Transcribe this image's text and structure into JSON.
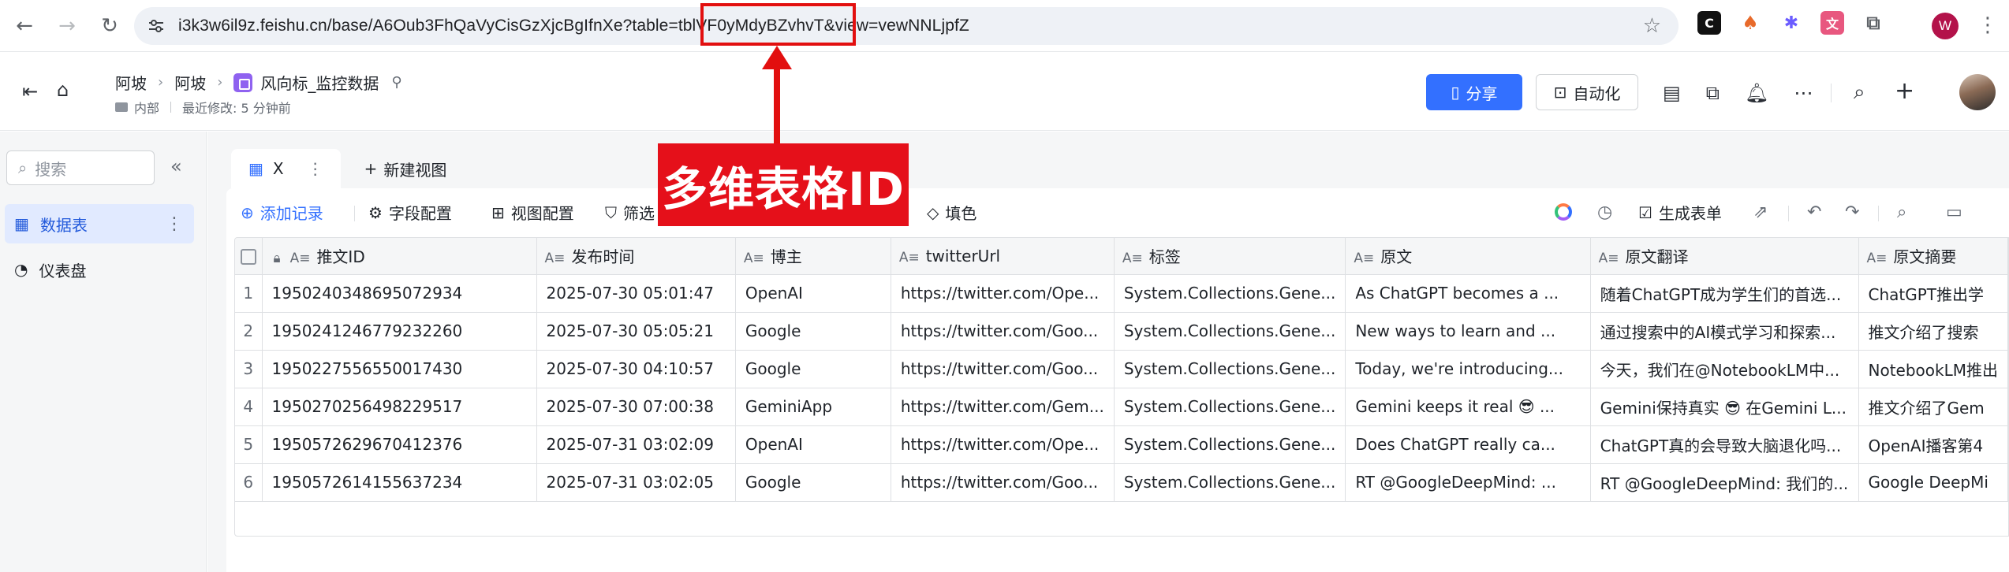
{
  "browser": {
    "url": "i3k3w6il9z.feishu.cn/base/A6Oub3FhQaVyCisGzXjcBgIfnXe?table=tblVF0yMdyBZvhvT&view=vewNNLjpfZ",
    "profile_initial": "W"
  },
  "header": {
    "breadcrumbs": [
      "阿坡",
      "阿坡"
    ],
    "doc_title": "风向标_监控数据",
    "visibility": "内部",
    "last_modified": "最近修改: 5 分钟前",
    "share_label": "分享",
    "automation_label": "自动化"
  },
  "sidebar": {
    "search_placeholder": "搜索",
    "items": [
      {
        "label": "数据表",
        "icon": "table-icon"
      },
      {
        "label": "仪表盘",
        "icon": "dashboard-icon"
      }
    ]
  },
  "views": {
    "active_tab": "X",
    "new_view_label": "新建视图"
  },
  "toolbar": {
    "add_record": "添加记录",
    "field_config": "字段配置",
    "view_config": "视图配置",
    "filter": "筛选",
    "fill_color": "填色",
    "generate_form": "生成表单"
  },
  "table": {
    "columns": [
      "推文ID",
      "发布时间",
      "博主",
      "twitterUrl",
      "标签",
      "原文",
      "原文翻译",
      "原文摘要"
    ],
    "rows": [
      {
        "n": "1",
        "cells": [
          "1950240348695072934",
          "2025-07-30 05:01:47",
          "OpenAI",
          "https://twitter.com/Ope...",
          "System.Collections.Gene...",
          "As ChatGPT becomes a ...",
          "随着ChatGPT成为学生们的首选...",
          "ChatGPT推出学"
        ]
      },
      {
        "n": "2",
        "cells": [
          "1950241246779232260",
          "2025-07-30 05:05:21",
          "Google",
          "https://twitter.com/Goo...",
          "System.Collections.Gene...",
          "New ways to learn and ...",
          "通过搜索中的AI模式学习和探索...",
          "推文介绍了搜索"
        ]
      },
      {
        "n": "3",
        "cells": [
          "1950227556550017430",
          "2025-07-30 04:10:57",
          "Google",
          "https://twitter.com/Goo...",
          "System.Collections.Gene...",
          "Today, we're introducing...",
          "今天，我们在@NotebookLM中...",
          "NotebookLM推出"
        ]
      },
      {
        "n": "4",
        "cells": [
          "1950270256498229517",
          "2025-07-30 07:00:38",
          "GeminiApp",
          "https://twitter.com/Gem...",
          "System.Collections.Gene...",
          "Gemini keeps it real 😎 ...",
          "Gemini保持真实 😎 在Gemini L...",
          "推文介绍了Gem"
        ]
      },
      {
        "n": "5",
        "cells": [
          "1950572629670412376",
          "2025-07-31 03:02:09",
          "OpenAI",
          "https://twitter.com/Ope...",
          "System.Collections.Gene...",
          "Does ChatGPT really ca...",
          "ChatGPT真的会导致大脑退化吗...",
          "OpenAI播客第4"
        ]
      },
      {
        "n": "6",
        "cells": [
          "1950572614155637234",
          "2025-07-31 03:02:05",
          "Google",
          "https://twitter.com/Goo...",
          "System.Collections.Gene...",
          "RT @GoogleDeepMind: ...",
          "RT @GoogleDeepMind: 我们的...",
          "Google DeepMi"
        ]
      }
    ]
  },
  "annotation": {
    "label": "多维表格ID",
    "color": "#e20f0f"
  },
  "colors": {
    "accent": "#3370ff",
    "annotation_red": "#e5101a"
  }
}
